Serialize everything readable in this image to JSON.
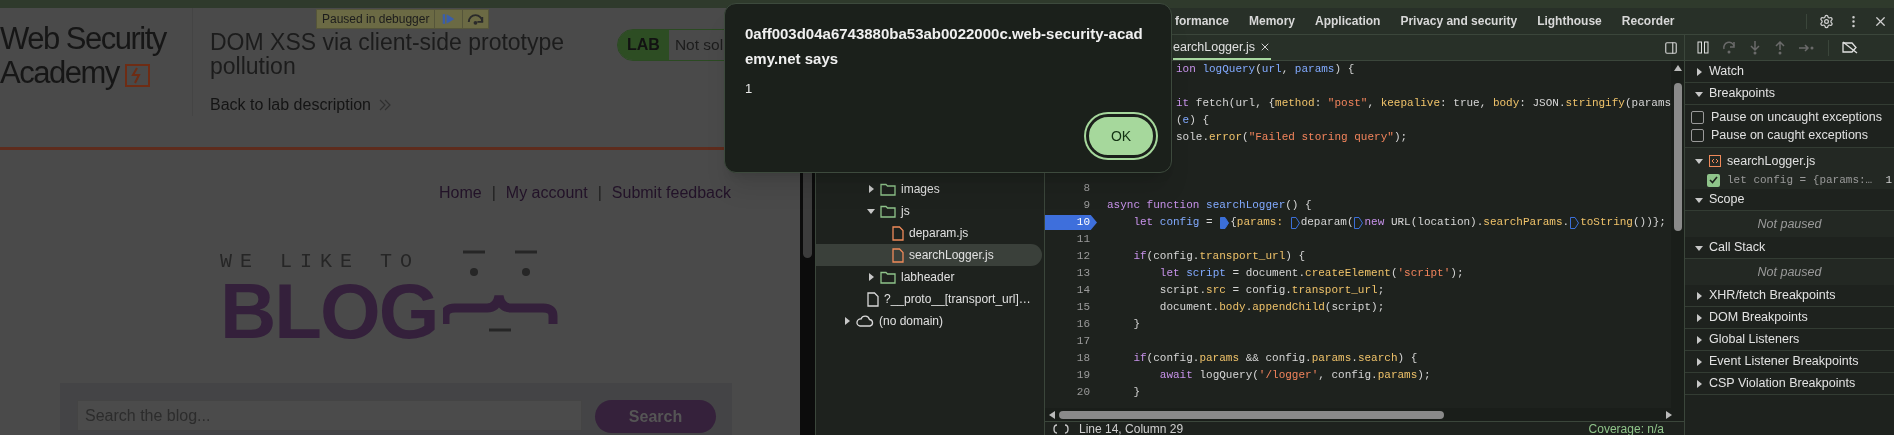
{
  "debugger_banner": {
    "label": "Paused in debugger"
  },
  "lab_page": {
    "logo": {
      "line1": "Web Security",
      "line2": "Academy"
    },
    "title": "DOM XSS via client-side prototype pollution",
    "back_link": "Back to lab description",
    "lab_badge": {
      "label": "LAB",
      "status": "Not sol"
    },
    "nav": [
      {
        "label": "Home"
      },
      {
        "label": "My account"
      },
      {
        "label": "Submit feedback"
      }
    ],
    "nav_separator": "|",
    "banner": {
      "tagline": "WE LIKE TO",
      "word": "BLOG"
    },
    "search": {
      "placeholder": "Search the blog...",
      "button": "Search"
    }
  },
  "dialog": {
    "title": "0aff003d04a6743880ba53ab0022000c.web-security-academy.net says",
    "message": "1",
    "button": "OK"
  },
  "devtools": {
    "tabs": [
      {
        "label": "formance",
        "selected": false
      },
      {
        "label": "Memory",
        "selected": false
      },
      {
        "label": "Application",
        "selected": false
      },
      {
        "label": "Privacy and security",
        "selected": false
      },
      {
        "label": "Lighthouse",
        "selected": false
      },
      {
        "label": "Recorder",
        "selected": false
      }
    ],
    "navigator": [
      {
        "kind": "covered",
        "children": [
          {
            "kind": "covered",
            "children": [
              {
                "kind": "folder",
                "label": "images",
                "expanded": false
              },
              {
                "kind": "folder",
                "label": "js",
                "expanded": true,
                "children": [
                  {
                    "kind": "script",
                    "label": "deparam.js",
                    "selected": false
                  },
                  {
                    "kind": "script",
                    "label": "searchLogger.js",
                    "selected": true
                  }
                ]
              },
              {
                "kind": "folder",
                "label": "labheader",
                "expanded": false
              },
              {
                "kind": "document",
                "label": "?__proto__[transport_url]…",
                "selected": false
              }
            ]
          }
        ]
      },
      {
        "kind": "domain",
        "label": "(no domain)",
        "expanded": false
      }
    ],
    "editor_tab": {
      "label": "earchLogger.js"
    },
    "covered_lines": [
      {
        "kind": "text",
        "tokens": [
          {
            "kind": "kw",
            "text": "ion"
          },
          {
            "kind": "def",
            "text": " logQuery"
          },
          {
            "kind": "plain",
            "text": "("
          },
          {
            "kind": "def",
            "text": "url"
          },
          {
            "kind": "plain",
            "text": ", "
          },
          {
            "kind": "def",
            "text": "params"
          },
          {
            "kind": "plain",
            "text": ") {"
          }
        ]
      },
      {
        "kind": "blank"
      },
      {
        "kind": "text",
        "tokens": [
          {
            "kind": "kw",
            "text": "it"
          },
          {
            "kind": "plain",
            "text": " fetch(url, {"
          },
          {
            "kind": "prop",
            "text": "method"
          },
          {
            "kind": "plain",
            "text": ": "
          },
          {
            "kind": "str",
            "text": "\"post\""
          },
          {
            "kind": "plain",
            "text": ", "
          },
          {
            "kind": "prop",
            "text": "keepalive"
          },
          {
            "kind": "plain",
            "text": ": true, "
          },
          {
            "kind": "prop",
            "text": "body"
          },
          {
            "kind": "plain",
            "text": ": JSON."
          },
          {
            "kind": "prop",
            "text": "stringify"
          },
          {
            "kind": "plain",
            "text": "(params"
          }
        ]
      },
      {
        "kind": "text",
        "tokens": [
          {
            "kind": "plain",
            "text": "("
          },
          {
            "kind": "def",
            "text": "e"
          },
          {
            "kind": "plain",
            "text": ") {"
          }
        ]
      },
      {
        "kind": "text",
        "tokens": [
          {
            "kind": "plain",
            "text": "sole."
          },
          {
            "kind": "prop",
            "text": "error"
          },
          {
            "kind": "plain",
            "text": "("
          },
          {
            "kind": "str",
            "text": "\"Failed storing query\""
          },
          {
            "kind": "plain",
            "text": ");"
          }
        ]
      },
      {
        "kind": "blank"
      },
      {
        "kind": "blank"
      }
    ],
    "lines": [
      {
        "number": "8",
        "breakpoint": false
      },
      {
        "number": "9",
        "breakpoint": false,
        "tokens": [
          {
            "kind": "kw",
            "text": "async"
          },
          {
            "kind": "kw",
            "text": " function"
          },
          {
            "kind": "def",
            "text": " searchLogger"
          },
          {
            "kind": "plain",
            "text": "() {"
          }
        ]
      },
      {
        "number": "10",
        "breakpoint": true,
        "tokens": [
          {
            "kind": "kw",
            "text": "    let"
          },
          {
            "kind": "def",
            "text": " config"
          },
          {
            "kind": "plain",
            "text": " = "
          },
          {
            "kind": "marker",
            "active": true
          },
          {
            "kind": "plain",
            "text": "{"
          },
          {
            "kind": "prop",
            "text": "params: "
          },
          {
            "kind": "marker",
            "active": false
          },
          {
            "kind": "plain",
            "text": "deparam("
          },
          {
            "kind": "marker",
            "active": false
          },
          {
            "kind": "kw",
            "text": "new"
          },
          {
            "kind": "plain",
            "text": " URL(location)."
          },
          {
            "kind": "prop",
            "text": "searchParams"
          },
          {
            "kind": "plain",
            "text": "."
          },
          {
            "kind": "marker",
            "active": false
          },
          {
            "kind": "prop",
            "text": "toString"
          },
          {
            "kind": "plain",
            "text": "())};"
          }
        ]
      },
      {
        "number": "11",
        "breakpoint": false
      },
      {
        "number": "12",
        "breakpoint": false,
        "tokens": [
          {
            "kind": "kw",
            "text": "    if"
          },
          {
            "kind": "plain",
            "text": "(config."
          },
          {
            "kind": "prop",
            "text": "transport_url"
          },
          {
            "kind": "plain",
            "text": ") {"
          }
        ]
      },
      {
        "number": "13",
        "breakpoint": false,
        "tokens": [
          {
            "kind": "kw",
            "text": "        let"
          },
          {
            "kind": "def",
            "text": " script"
          },
          {
            "kind": "plain",
            "text": " = document."
          },
          {
            "kind": "prop",
            "text": "createElement"
          },
          {
            "kind": "plain",
            "text": "("
          },
          {
            "kind": "str",
            "text": "'script'"
          },
          {
            "kind": "plain",
            "text": ");"
          }
        ]
      },
      {
        "number": "14",
        "breakpoint": false,
        "tokens": [
          {
            "kind": "plain",
            "text": "        script."
          },
          {
            "kind": "prop",
            "text": "src"
          },
          {
            "kind": "plain",
            "text": " = config."
          },
          {
            "kind": "prop",
            "text": "transport_url"
          },
          {
            "kind": "plain",
            "text": ";"
          }
        ]
      },
      {
        "number": "15",
        "breakpoint": false,
        "tokens": [
          {
            "kind": "plain",
            "text": "        document."
          },
          {
            "kind": "prop",
            "text": "body"
          },
          {
            "kind": "plain",
            "text": "."
          },
          {
            "kind": "prop",
            "text": "appendChild"
          },
          {
            "kind": "plain",
            "text": "(script);"
          }
        ]
      },
      {
        "number": "16",
        "breakpoint": false,
        "tokens": [
          {
            "kind": "plain",
            "text": "    }"
          }
        ]
      },
      {
        "number": "17",
        "breakpoint": false
      },
      {
        "number": "18",
        "breakpoint": false,
        "tokens": [
          {
            "kind": "kw",
            "text": "    if"
          },
          {
            "kind": "plain",
            "text": "(config."
          },
          {
            "kind": "prop",
            "text": "params"
          },
          {
            "kind": "plain",
            "text": " && config."
          },
          {
            "kind": "prop",
            "text": "params"
          },
          {
            "kind": "plain",
            "text": "."
          },
          {
            "kind": "prop",
            "text": "search"
          },
          {
            "kind": "plain",
            "text": ") {"
          }
        ]
      },
      {
        "number": "19",
        "breakpoint": false,
        "tokens": [
          {
            "kind": "kw",
            "text": "        await"
          },
          {
            "kind": "plain",
            "text": " logQuery("
          },
          {
            "kind": "str",
            "text": "'/logger'"
          },
          {
            "kind": "plain",
            "text": ", config."
          },
          {
            "kind": "prop",
            "text": "params"
          },
          {
            "kind": "plain",
            "text": ");"
          }
        ]
      },
      {
        "number": "20",
        "breakpoint": false,
        "tokens": [
          {
            "kind": "plain",
            "text": "    }"
          }
        ]
      }
    ],
    "status": {
      "position": "Line 14, Column 29",
      "coverage": "Coverage: n/a"
    },
    "sidebar": [
      {
        "title": "Watch",
        "expanded": false
      },
      {
        "title": "Breakpoints",
        "expanded": true,
        "options": [
          {
            "label": "Pause on uncaught exceptions",
            "checked": false
          },
          {
            "label": "Pause on caught exceptions",
            "checked": false
          }
        ],
        "files": [
          {
            "name": "searchLogger.js",
            "expanded": true,
            "breakpoints": [
              {
                "code": "let config = {params:…",
                "line": "1",
                "checked": true
              }
            ]
          }
        ]
      },
      {
        "title": "Scope",
        "expanded": true,
        "empty": "Not paused"
      },
      {
        "title": "Call Stack",
        "expanded": true,
        "empty": "Not paused"
      },
      {
        "title": "XHR/fetch Breakpoints",
        "expanded": false
      },
      {
        "title": "DOM Breakpoints",
        "expanded": false
      },
      {
        "title": "Global Listeners",
        "expanded": false
      },
      {
        "title": "Event Listener Breakpoints",
        "expanded": false
      },
      {
        "title": "CSP Violation Breakpoints",
        "expanded": false
      }
    ]
  }
}
